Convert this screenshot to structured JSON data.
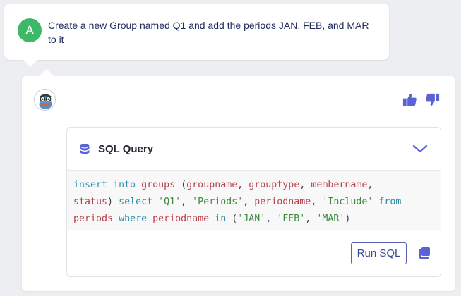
{
  "user_message": {
    "avatar_letter": "A",
    "text": "Create a new Group named Q1 and add the periods JAN, FEB, and MAR to it"
  },
  "bot_response": {
    "feedback": {
      "thumbs_up_icon": "thumbs-up-icon",
      "thumbs_down_icon": "thumbs-down-icon"
    },
    "sql_panel": {
      "title": "SQL Query",
      "query_tokens": [
        {
          "t": "insert",
          "c": "kw"
        },
        {
          "t": " "
        },
        {
          "t": "into",
          "c": "kw"
        },
        {
          "t": " "
        },
        {
          "t": "groups",
          "c": "id"
        },
        {
          "t": " ("
        },
        {
          "t": "groupname",
          "c": "id"
        },
        {
          "t": ", "
        },
        {
          "t": "grouptype",
          "c": "id"
        },
        {
          "t": ", "
        },
        {
          "t": "membername",
          "c": "id"
        },
        {
          "t": ",\n"
        },
        {
          "t": "status",
          "c": "id"
        },
        {
          "t": ") "
        },
        {
          "t": "select",
          "c": "kw"
        },
        {
          "t": " "
        },
        {
          "t": "'Q1'",
          "c": "str"
        },
        {
          "t": ", "
        },
        {
          "t": "'Periods'",
          "c": "str"
        },
        {
          "t": ", "
        },
        {
          "t": "periodname",
          "c": "id"
        },
        {
          "t": ", "
        },
        {
          "t": "'Include'",
          "c": "str"
        },
        {
          "t": " "
        },
        {
          "t": "from",
          "c": "kw"
        },
        {
          "t": "\n"
        },
        {
          "t": "periods",
          "c": "id"
        },
        {
          "t": " "
        },
        {
          "t": "where",
          "c": "kw"
        },
        {
          "t": " "
        },
        {
          "t": "periodname",
          "c": "id"
        },
        {
          "t": " "
        },
        {
          "t": "in",
          "c": "kw"
        },
        {
          "t": " ("
        },
        {
          "t": "'JAN'",
          "c": "str"
        },
        {
          "t": ", "
        },
        {
          "t": "'FEB'",
          "c": "str"
        },
        {
          "t": ", "
        },
        {
          "t": "'MAR'",
          "c": "str"
        },
        {
          "t": ")"
        }
      ],
      "run_button_label": "Run SQL"
    }
  },
  "colors": {
    "user_avatar": "#3cb867",
    "accent": "#5a62d6",
    "keyword": "#2c8fa8",
    "identifier": "#b7404b",
    "string": "#3d8a3d"
  }
}
